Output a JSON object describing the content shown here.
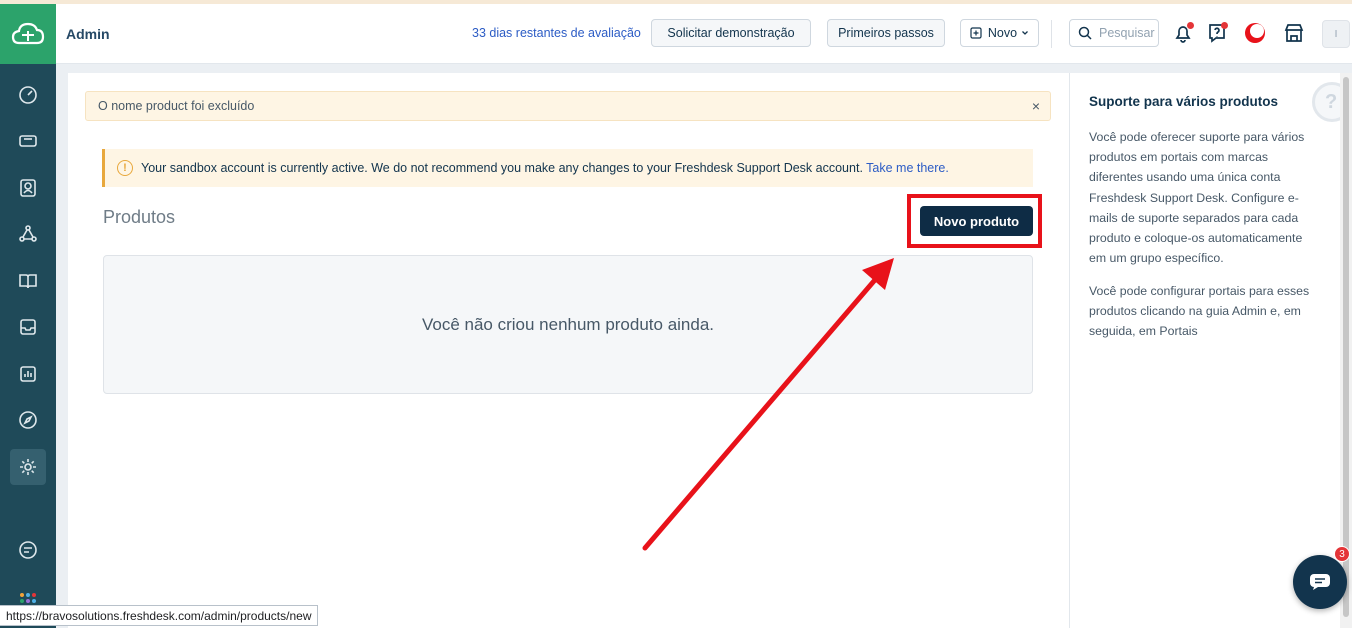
{
  "header": {
    "title": "Admin",
    "trial_text": "33 dias restantes de avaliação",
    "demo_button": "Solicitar demonstração",
    "start_button": "Primeiros passos",
    "new_button": "Novo",
    "search_placeholder": "Pesquisar",
    "avatar_initial": "I"
  },
  "sidebar": {
    "items": [
      "dashboard-icon",
      "tickets-icon",
      "contacts-icon",
      "groups-icon",
      "knowledge-base-icon",
      "inbox-icon",
      "reports-icon",
      "discover-icon",
      "admin-gear-icon",
      "chat-icon"
    ],
    "active": "admin-gear-icon"
  },
  "notice": {
    "text": "O nome product foi excluído",
    "close": "×"
  },
  "sandbox": {
    "text": "Your sandbox account is currently active. We do not recommend you make any changes to your Freshdesk Support Desk account.",
    "link": "Take me there."
  },
  "products": {
    "title": "Produtos",
    "new_button": "Novo produto",
    "empty_text": "Você não criou nenhum produto ainda."
  },
  "right_panel": {
    "title": "Suporte para vários produtos",
    "paragraph1": "Você pode oferecer suporte para vários produtos em portais com marcas diferentes usando uma única conta Freshdesk Support Desk. Configure e-mails de suporte separados para cada produto e coloque-os automaticamente em um grupo específico.",
    "paragraph2": "Você pode configurar portais para esses produtos clicando na guia Admin e, em seguida, em Portais"
  },
  "chat_widget": {
    "badge": "3"
  },
  "status_url": "https://bravosolutions.freshdesk.com/admin/products/new",
  "colors": {
    "sidebar": "#1f4a59",
    "logo_bg": "#2ca36b",
    "primary_button": "#0e2c45",
    "annotation": "#e8121a"
  }
}
